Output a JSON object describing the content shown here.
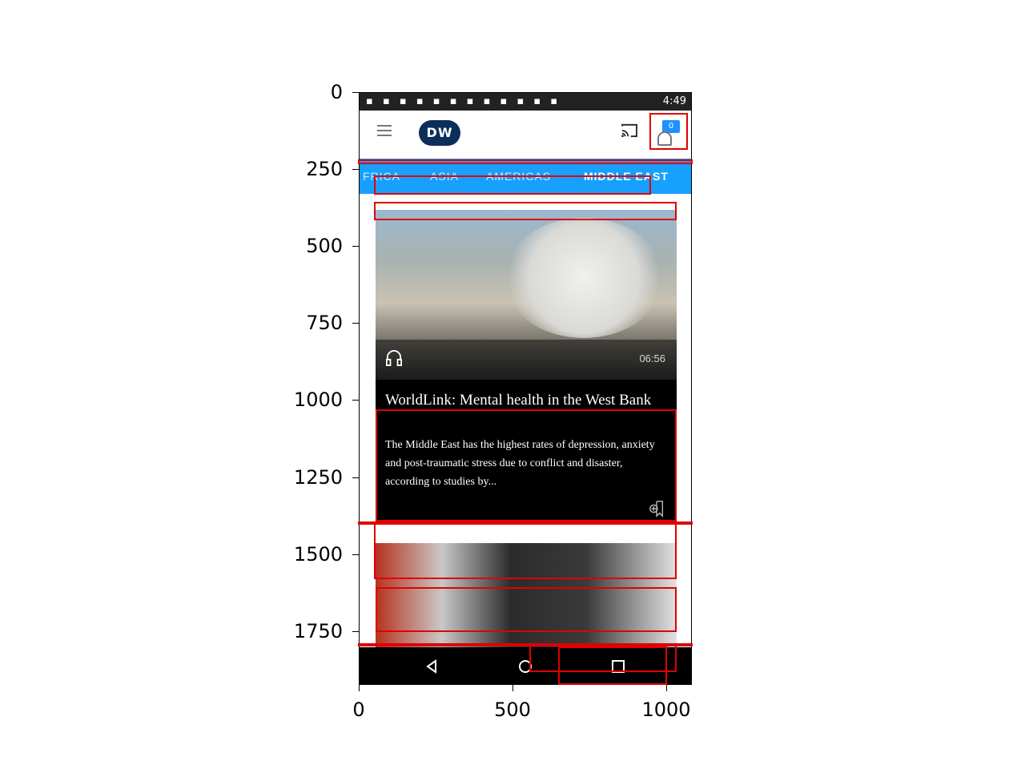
{
  "axes": {
    "y_ticks": [
      "0",
      "250",
      "500",
      "750",
      "1000",
      "1250",
      "1500",
      "1750"
    ],
    "x_ticks": [
      "0",
      "500",
      "1000"
    ]
  },
  "statusbar": {
    "time": "4:49"
  },
  "tabs": [
    {
      "label": "FRICA",
      "active": false
    },
    {
      "label": "ASIA",
      "active": false
    },
    {
      "label": "AMERICAS",
      "active": false
    },
    {
      "label": "MIDDLE EAST",
      "active": true
    }
  ],
  "app": {
    "logo_text": "DW",
    "notification_count": "0"
  },
  "article": {
    "duration": "06:56",
    "title": "WorldLink: Mental health in the West Bank",
    "description": "The Middle East has the highest rates of depression, anxiety and post-traumatic stress due to conflict and disaster, according to studies by..."
  },
  "icons": {
    "menu": "hamburger-menu-icon",
    "cast": "cast-icon",
    "notifications": "notification-bubble-icon",
    "audio": "headphones-icon",
    "bookmark": "bookmark-add-icon",
    "back": "back-triangle-icon",
    "home": "home-circle-icon",
    "recents": "recents-square-icon"
  },
  "colors": {
    "tab_bar": "#18a0ff",
    "logo": "#0b2f5a",
    "notification": "#1e90ff"
  }
}
